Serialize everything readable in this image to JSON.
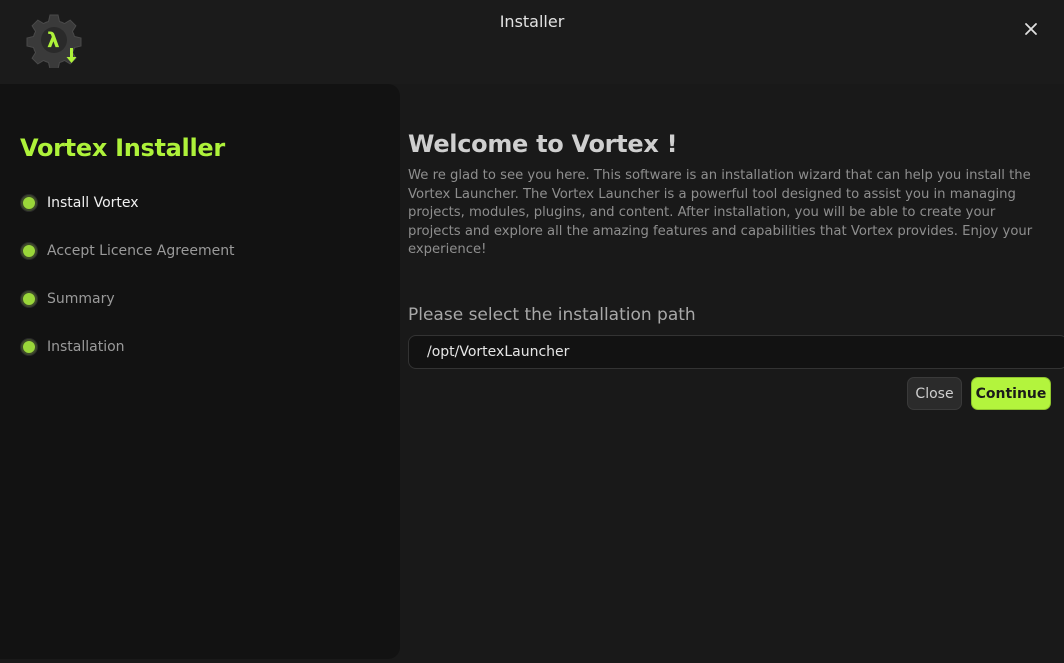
{
  "window": {
    "title": "Installer"
  },
  "sidebar": {
    "title": "Vortex Installer",
    "steps": [
      {
        "label": "Install Vortex",
        "active": true
      },
      {
        "label": "Accept Licence Agreement",
        "active": false
      },
      {
        "label": "Summary",
        "active": false
      },
      {
        "label": "Installation",
        "active": false
      }
    ]
  },
  "main": {
    "title": "Welcome to Vortex !",
    "description": "We re glad to see you here. This software is an installation wizard that can help you install the Vortex Launcher. The Vortex Launcher is a powerful tool designed to assist you in managing projects, modules, plugins, and content. After installation, you will be able to create your projects and explore all the amazing features and capabilities that Vortex provides. Enjoy your experience!",
    "path_label": "Please select the installation path",
    "path_value": "/opt/VortexLauncher"
  },
  "buttons": {
    "close": "Close",
    "continue": "Continue"
  },
  "icons": {
    "logo": "gear-lambda-download-icon",
    "close": "close-icon"
  },
  "colors": {
    "accent": "#aef23a",
    "background": "#191919",
    "sidebar": "#121212"
  }
}
